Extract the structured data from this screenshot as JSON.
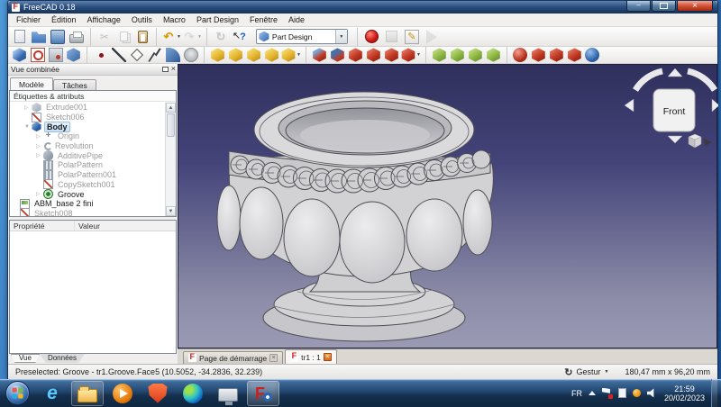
{
  "window": {
    "title": "FreeCAD 0.18"
  },
  "menu": {
    "items": [
      "Fichier",
      "Édition",
      "Affichage",
      "Outils",
      "Macro",
      "Part Design",
      "Fenêtre",
      "Aide"
    ]
  },
  "toolbar_row1_groups": [
    {
      "buttons": [
        {
          "icon": "new-document"
        },
        {
          "icon": "open-folder"
        },
        {
          "icon": "save"
        },
        {
          "icon": "print"
        }
      ]
    },
    {
      "buttons": [
        {
          "icon": "cut-scissors",
          "disabled": true
        },
        {
          "icon": "copy",
          "disabled": true
        },
        {
          "icon": "paste"
        }
      ]
    },
    {
      "buttons": [
        {
          "icon": "undo-arrow",
          "dropdown": true
        },
        {
          "icon": "redo-arrow",
          "dropdown": true,
          "disabled": true
        }
      ]
    },
    {
      "buttons": [
        {
          "icon": "refresh",
          "disabled": true
        },
        {
          "icon": "whats-this"
        }
      ]
    }
  ],
  "workbench": {
    "selected": "Part Design"
  },
  "macro_buttons": [
    {
      "icon": "record-red"
    },
    {
      "icon": "stop-grey",
      "disabled": true
    },
    {
      "icon": "macro-edit"
    },
    {
      "icon": "play-grey",
      "disabled": true
    }
  ],
  "toolbar_row2_groups": [
    {
      "buttons": [
        {
          "icon": "create-body"
        },
        {
          "icon": "create-sketch"
        },
        {
          "icon": "map-sketch"
        },
        {
          "icon": "edit-sketch"
        }
      ]
    },
    {
      "buttons": [
        {
          "icon": "sketcher-point"
        },
        {
          "icon": "sketcher-line"
        },
        {
          "icon": "sketcher-rectangle"
        },
        {
          "icon": "sketcher-polyline"
        },
        {
          "icon": "sketcher-fillet"
        },
        {
          "icon": "sketcher-external"
        }
      ]
    },
    {
      "buttons": [
        {
          "icon": "pad"
        },
        {
          "icon": "revolution-tool"
        },
        {
          "icon": "additive-loft"
        },
        {
          "icon": "additive-pipe"
        },
        {
          "icon": "additive-primitive",
          "dropdown": true
        }
      ]
    },
    {
      "buttons": [
        {
          "icon": "pocket"
        },
        {
          "icon": "hole"
        },
        {
          "icon": "groove-tool"
        },
        {
          "icon": "subtractive-loft"
        },
        {
          "icon": "subtractive-pipe"
        },
        {
          "icon": "subtractive-primitive",
          "dropdown": true
        }
      ]
    },
    {
      "buttons": [
        {
          "icon": "mirrored"
        },
        {
          "icon": "linear-pattern"
        },
        {
          "icon": "polar-pattern"
        },
        {
          "icon": "multitransform"
        }
      ]
    },
    {
      "buttons": [
        {
          "icon": "fillet"
        },
        {
          "icon": "chamfer"
        },
        {
          "icon": "draft"
        },
        {
          "icon": "thickness"
        },
        {
          "icon": "boolean"
        }
      ]
    }
  ],
  "combined_view": {
    "title": "Vue combinée",
    "tabs": [
      {
        "label": "Modèle",
        "active": true
      },
      {
        "label": "Tâches"
      }
    ],
    "tree_header": "Étiquettes & attributs",
    "tree_items": [
      {
        "label": "Extrude001",
        "icon": "extrude",
        "depth": 1,
        "arrow": "▷",
        "muted": true
      },
      {
        "label": "Sketch006",
        "icon": "sketch",
        "depth": 1,
        "arrow": "",
        "muted": true
      },
      {
        "label": "Body",
        "icon": "body",
        "depth": 1,
        "arrow": "▼",
        "selected": true,
        "bold": true
      },
      {
        "label": "Origin",
        "icon": "origin",
        "depth": 2,
        "arrow": "▷",
        "muted": true
      },
      {
        "label": "Revolution",
        "icon": "revolution",
        "depth": 2,
        "arrow": "▷",
        "muted": true
      },
      {
        "label": "AdditivePipe",
        "icon": "pipe",
        "depth": 2,
        "arrow": "▷",
        "muted": true
      },
      {
        "label": "PolarPattern",
        "icon": "pattern",
        "depth": 2,
        "arrow": "",
        "muted": true
      },
      {
        "label": "PolarPattern001",
        "icon": "pattern",
        "depth": 2,
        "arrow": "",
        "muted": true
      },
      {
        "label": "CopySketch001",
        "icon": "sketch",
        "depth": 2,
        "arrow": "",
        "muted": true
      },
      {
        "label": "Groove",
        "icon": "groove",
        "depth": 2,
        "arrow": "▷"
      },
      {
        "label": "ABM_base 2 fini",
        "icon": "document",
        "depth": 0,
        "arrow": ""
      },
      {
        "label": "Sketch008",
        "icon": "sketch",
        "depth": 0,
        "arrow": "",
        "muted": true
      }
    ],
    "property_columns": [
      "Propriété",
      "Valeur"
    ],
    "bottom_tabs": [
      {
        "label": "Vue",
        "active": true
      },
      {
        "label": "Données"
      }
    ]
  },
  "viewport": {
    "nav_cube": {
      "front_label": "Front"
    },
    "mdi_tabs": [
      {
        "label": "Page de démarrage"
      },
      {
        "label": "tr1 : 1",
        "active": true
      }
    ]
  },
  "status_bar": {
    "message": "Preselected: Groove - tr1.Groove.Face5 (10.5052, -34.2836, 32.239)",
    "nav_style_label": "Gestur",
    "dimensions": "180,47 mm x 96,20 mm"
  },
  "taskbar": {
    "apps": [
      {
        "icon": "internet-explorer"
      },
      {
        "icon": "windows-explorer",
        "open": true
      },
      {
        "icon": "media-player"
      },
      {
        "icon": "brave"
      },
      {
        "icon": "edge"
      },
      {
        "icon": "display"
      },
      {
        "icon": "freecad",
        "open": true,
        "foreground": true
      }
    ],
    "tray": {
      "language": "FR",
      "time": "21:59",
      "date": "20/02/2023"
    }
  },
  "colors": {
    "viewport_top": "#30305d",
    "viewport_bottom": "#9b9ab5",
    "selection": "#c4e0f5",
    "titlebar": "#2c5080"
  }
}
